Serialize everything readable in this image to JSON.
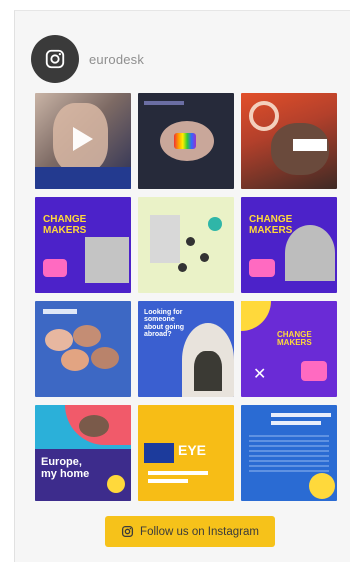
{
  "profile": {
    "username": "eurodesk"
  },
  "posts": [
    {
      "title": "",
      "subtitle": ""
    },
    {
      "title": "",
      "subtitle": ""
    },
    {
      "title": "",
      "subtitle": ""
    },
    {
      "title": "CHANGE\nMAKERS",
      "subtitle": ""
    },
    {
      "title": "",
      "subtitle": ""
    },
    {
      "title": "CHANGE\nMAKERS",
      "subtitle": ""
    },
    {
      "title": "",
      "subtitle": ""
    },
    {
      "title": "Looking for\nsomeone\nabout going\nabroad?",
      "subtitle": ""
    },
    {
      "title": "CHANGE\nMAKERS",
      "subtitle": ""
    },
    {
      "title": "Europe,\nmy home",
      "subtitle": ""
    },
    {
      "title": "EYE",
      "subtitle": ""
    },
    {
      "title": "",
      "subtitle": ""
    }
  ],
  "follow_button": {
    "label": "Follow us on Instagram"
  },
  "colors": {
    "accent": "#f6c21a",
    "eurodesk_purple": "#5a2bd6",
    "eurodesk_blue": "#2f6fd1",
    "avatar_bg": "#3a3a3a"
  }
}
